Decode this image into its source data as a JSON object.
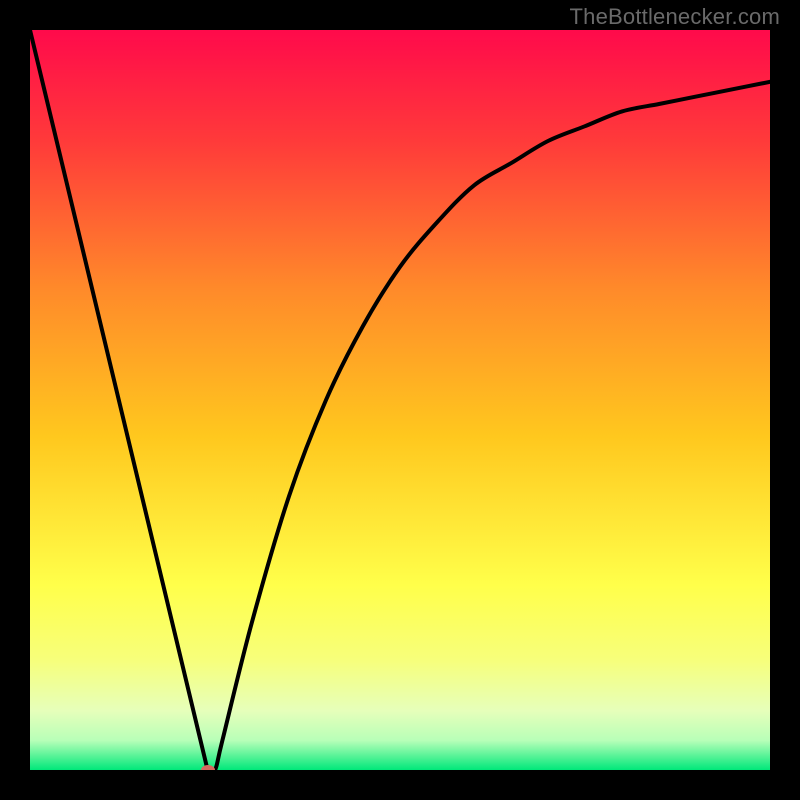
{
  "watermark": "TheBottlenecker.com",
  "colors": {
    "frame": "#000000",
    "curve": "#000000",
    "dot": "#d46a5f",
    "gradient_stops": [
      {
        "pct": 0,
        "color": "#ff0a4b"
      },
      {
        "pct": 15,
        "color": "#ff3a3a"
      },
      {
        "pct": 35,
        "color": "#ff8a2a"
      },
      {
        "pct": 55,
        "color": "#ffc81e"
      },
      {
        "pct": 75,
        "color": "#ffff4a"
      },
      {
        "pct": 85,
        "color": "#f7ff7a"
      },
      {
        "pct": 92,
        "color": "#e6ffba"
      },
      {
        "pct": 96,
        "color": "#b8ffb8"
      },
      {
        "pct": 100,
        "color": "#00e87a"
      }
    ]
  },
  "chart_data": {
    "type": "line",
    "title": "",
    "xlabel": "",
    "ylabel": "",
    "xlim": [
      0,
      100
    ],
    "ylim": [
      0,
      100
    ],
    "x": [
      0,
      5,
      10,
      15,
      20,
      24,
      25,
      26,
      30,
      35,
      40,
      45,
      50,
      55,
      60,
      65,
      70,
      75,
      80,
      85,
      90,
      95,
      100
    ],
    "values": [
      100,
      79,
      58,
      38,
      17,
      0,
      0,
      4,
      20,
      37,
      50,
      60,
      68,
      74,
      79,
      82,
      85,
      87,
      89,
      90,
      91,
      92,
      93
    ],
    "marker": {
      "x": 24,
      "y": 0
    },
    "annotations": []
  }
}
